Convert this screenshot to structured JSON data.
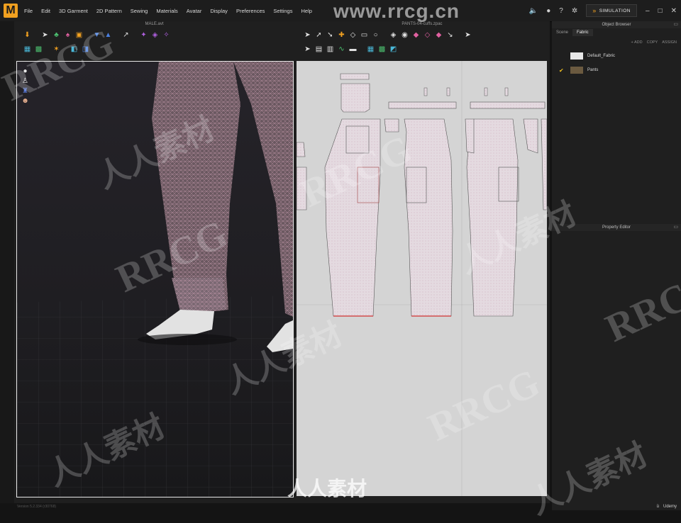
{
  "app": {
    "logo": "M",
    "menus": [
      "File",
      "Edit",
      "3D Garment",
      "2D Pattern",
      "Sewing",
      "Materials",
      "Avatar",
      "Display",
      "Preferences",
      "Settings",
      "Help"
    ],
    "simulation_label": "SIMULATION"
  },
  "windows": {
    "avatar_title": "MALE.avt",
    "pattern_title": "PANTS-04-cuffs.zpac"
  },
  "object_browser": {
    "title": "Object Browser",
    "tabs": [
      "Scene",
      "Fabric"
    ],
    "active_tab": "Fabric",
    "actions": [
      "+ ADD",
      "COPY",
      "ASSIGN"
    ],
    "fabrics": [
      {
        "name": "Default_Fabric",
        "color": "#e8e8e8",
        "checked": false
      },
      {
        "name": "Pants",
        "color": "#6b5a40",
        "checked": true
      }
    ]
  },
  "property_editor": {
    "title": "Property Editor"
  },
  "watermark": {
    "url": "www.rrcg.cn",
    "text_latin": "RRCG",
    "text_chinese": "人人素材"
  },
  "status": {
    "left": "Version 5.2.334 (r30768)"
  },
  "udemy_label": "Udemy",
  "colors": {
    "accent": "#f0a020",
    "mesh": "#d8a8b8",
    "pattern_fill": "#e6dce2"
  }
}
